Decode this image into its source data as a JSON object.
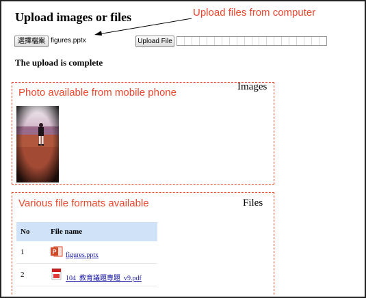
{
  "page": {
    "title": "Upload images or files",
    "status": "The upload is complete"
  },
  "annotations": {
    "upload_note": "Upload files from computer",
    "images_note": "Photo available from mobile phone",
    "files_note": "Various file formats available",
    "color": "#e8472d"
  },
  "uploader": {
    "choose_button": "選擇檔案",
    "chosen_file": "figures.pptx",
    "upload_button": "Upload File",
    "progress_fraction": 0
  },
  "images_section": {
    "label": "Images"
  },
  "files_section": {
    "label": "Files",
    "columns": [
      "No",
      "File name"
    ],
    "rows": [
      {
        "no": "1",
        "name": "figures.pptx",
        "icon": "powerpoint-icon"
      },
      {
        "no": "2",
        "name": "104_教育議題專題_v9.pdf",
        "icon": "pdf-icon"
      }
    ],
    "header_color": "#cfe2f7"
  }
}
